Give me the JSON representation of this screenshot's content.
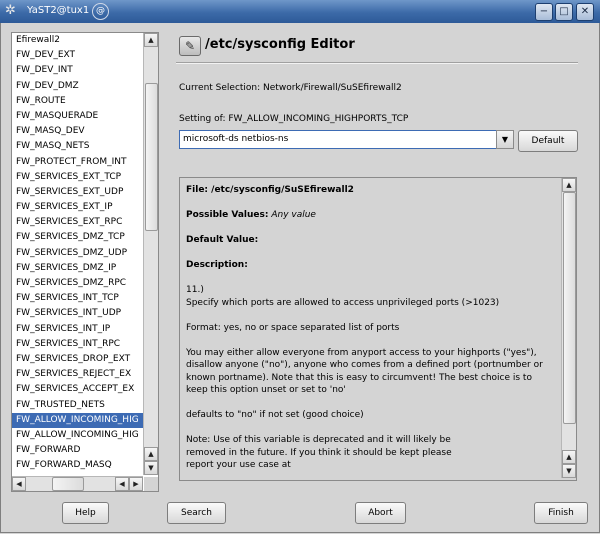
{
  "window": {
    "title": "YaST2@tux1",
    "pin_glyph": "@",
    "controls": {
      "minimize": "−",
      "maximize": "□",
      "close": "✕"
    }
  },
  "variables": {
    "items": [
      "Efirewall2",
      "FW_DEV_EXT",
      "FW_DEV_INT",
      "FW_DEV_DMZ",
      "FW_ROUTE",
      "FW_MASQUERADE",
      "FW_MASQ_DEV",
      "FW_MASQ_NETS",
      "FW_PROTECT_FROM_INT",
      "FW_SERVICES_EXT_TCP",
      "FW_SERVICES_EXT_UDP",
      "FW_SERVICES_EXT_IP",
      "FW_SERVICES_EXT_RPC",
      "FW_SERVICES_DMZ_TCP",
      "FW_SERVICES_DMZ_UDP",
      "FW_SERVICES_DMZ_IP",
      "FW_SERVICES_DMZ_RPC",
      "FW_SERVICES_INT_TCP",
      "FW_SERVICES_INT_UDP",
      "FW_SERVICES_INT_IP",
      "FW_SERVICES_INT_RPC",
      "FW_SERVICES_DROP_EXT",
      "FW_SERVICES_REJECT_EX",
      "FW_SERVICES_ACCEPT_EX",
      "FW_TRUSTED_NETS",
      "FW_ALLOW_INCOMING_HIG",
      "FW_ALLOW_INCOMING_HIG",
      "FW_FORWARD",
      "FW_FORWARD_MASQ"
    ],
    "selected_index": 25
  },
  "editor": {
    "title": "/etc/sysconfig Editor",
    "current_selection": "Current Selection: Network/Firewall/SuSEfirewall2",
    "setting_label": "Setting of: FW_ALLOW_INCOMING_HIGHPORTS_TCP",
    "value": "microsoft-ds netbios-ns",
    "default_button": "Default",
    "info": {
      "file": "File: /etc/sysconfig/SuSEfirewall2",
      "possible_label": "Possible Values:",
      "possible_value": "Any value",
      "default_label": "Default Value:",
      "description_label": "Description:",
      "lines": [
        "11.)",
        "Specify which ports are allowed to access unprivileged ports (>1023)",
        "",
        "Format: yes, no or space separated list of ports",
        "",
        "You may either allow everyone from anyport access to your highports (\"yes\"),",
        "disallow anyone (\"no\"), anyone who comes from a defined port (portnumber or",
        "known portname). Note that this is easy to circumvent! The best choice is to",
        "keep this option unset or set to 'no'",
        "",
        "defaults to \"no\" if not set (good choice)",
        "",
        "Note: Use of this variable is deprecated and it will likely be",
        "removed in the future. If you think it should be kept please",
        "report your use case at"
      ]
    }
  },
  "buttons": {
    "help": "Help",
    "search": "Search",
    "abort": "Abort",
    "finish": "Finish"
  },
  "colors": {
    "title_bar": "#3c6aa8",
    "selection": "#3d6bb4"
  },
  "icons": {
    "app": "yast-icon",
    "header": "sysconfig-editor-icon",
    "scroll_up": "▲",
    "scroll_down": "▼",
    "scroll_left": "◀",
    "scroll_right": "▶",
    "combo_arrow": "▼"
  }
}
